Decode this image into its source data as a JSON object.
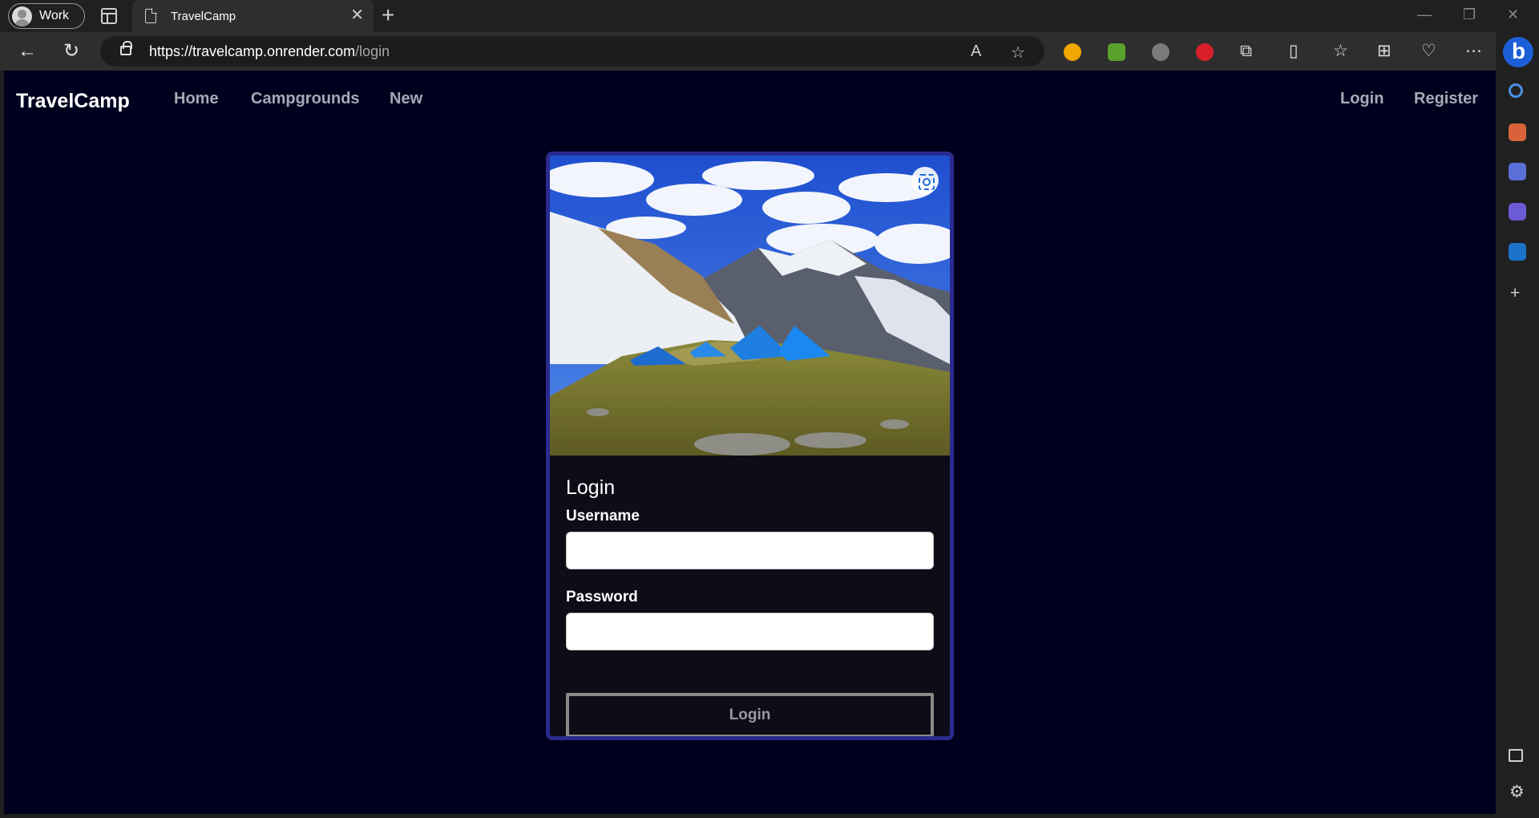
{
  "browser": {
    "profile_label": "Work",
    "tab_title": "TravelCamp",
    "url_host": "https://travelcamp.onrender.com",
    "url_path": "/login"
  },
  "site": {
    "brand": "TravelCamp",
    "nav_left": [
      "Home",
      "Campgrounds",
      "New"
    ],
    "nav_right": [
      "Login",
      "Register"
    ]
  },
  "login_form": {
    "title": "Login",
    "username_label": "Username",
    "username_value": "",
    "password_label": "Password",
    "password_value": "",
    "submit_label": "Login"
  },
  "colors": {
    "page_background": "#00001e",
    "card_border": "#2a2a8f",
    "card_background": "#0c0d17",
    "nav_link": "#a9a9b6"
  }
}
